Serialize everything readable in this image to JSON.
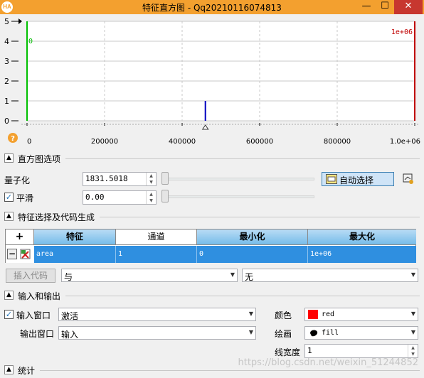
{
  "window": {
    "title": "特征直方图 - Qq20210116074813",
    "icon_text": "HA",
    "minimize": "—",
    "maximize": "☐",
    "close": "✕"
  },
  "histogram": {
    "y_ticks": [
      "5",
      "4",
      "3",
      "2",
      "1",
      "0"
    ],
    "x_ticks": [
      "0",
      "200000",
      "400000",
      "600000",
      "800000",
      "1.0e+06"
    ],
    "min_marker_label": "0",
    "max_marker_label": "1e+06",
    "colors": {
      "min_line": "#00c000",
      "max_line": "#c00000",
      "bar": "#0000c0",
      "grid": "#c8c8c8"
    },
    "help_icon": "question-icon"
  },
  "chart_data": {
    "type": "bar",
    "x": [
      460000
    ],
    "values": [
      1
    ],
    "xlim": [
      0,
      1000000
    ],
    "ylim": [
      0,
      5
    ],
    "xticks": [
      "0",
      "200000",
      "400000",
      "600000",
      "800000",
      "1.0e+06"
    ],
    "yticks": [
      "0",
      "1",
      "2",
      "3",
      "4",
      "5"
    ],
    "min_marker": 0,
    "max_marker": 1000000,
    "grid": true
  },
  "histogram_options": {
    "section_label": "直方图选项",
    "quantization_label": "量子化",
    "quantization_value": "1831.5018",
    "smooth_label": "平滑",
    "smooth_checked": true,
    "smooth_value": "0.00",
    "auto_select_label": "自动选择",
    "auto_icon": "auto-icon",
    "save_icon": "save-histogram-icon"
  },
  "feature_section": {
    "section_label": "特征选择及代码生成",
    "columns": [
      "特征",
      "通道",
      "最小化",
      "最大化"
    ],
    "add_symbol": "+",
    "remove_symbol": "−",
    "row": {
      "feature": "area",
      "channel": "1",
      "min": "0",
      "max": "1e+06"
    },
    "insert_code_label": "插入代码",
    "combo_logic": "与",
    "combo_other": "无"
  },
  "io_section": {
    "section_label": "输入和输出",
    "input_window_label": "输入窗口",
    "input_window_checked": true,
    "input_window_value": "激活",
    "output_window_label": "输出窗口",
    "output_window_value": "输入",
    "color_label": "颜色",
    "color_value": "red",
    "color_swatch": "#ff0000",
    "draw_label": "绘画",
    "draw_value": "fill",
    "line_width_label": "线宽度",
    "line_width_value": "1"
  },
  "stats_section": {
    "section_label": "统计"
  },
  "watermark": "https://blog.csdn.net/weixin_51244852"
}
